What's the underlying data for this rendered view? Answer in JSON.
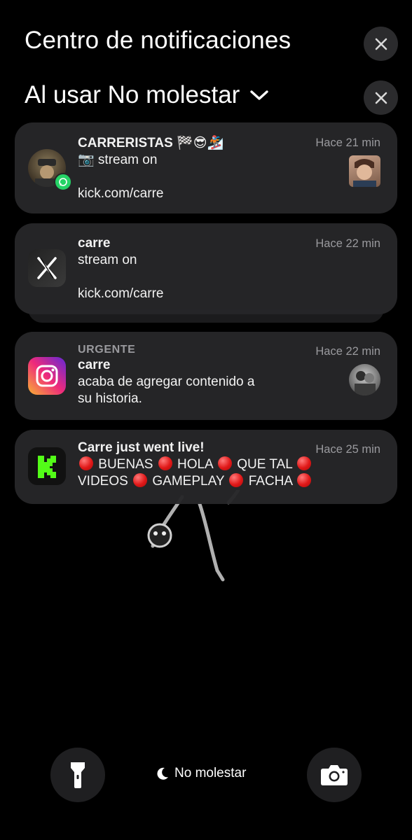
{
  "header": {
    "title": "Centro de notificaciones",
    "focus_label": "Al usar No molestar"
  },
  "notifications": [
    {
      "app": "WhatsApp",
      "sender": "CARRERISTAS 🏁😎🏂",
      "line1": "📷 stream on",
      "line2": "kick.com/carre",
      "time": "Hace 21 min"
    },
    {
      "app": "X",
      "sender": "carre",
      "line1": "stream on",
      "line2": "kick.com/carre",
      "time": "Hace 22 min"
    },
    {
      "app": "Instagram",
      "tag": "URGENTE",
      "sender": "carre",
      "line1": "acaba de agregar contenido a",
      "line2": "su historia.",
      "time": "Hace 22 min"
    },
    {
      "app": "Kick",
      "sender": "Carre just went live!",
      "words_line1": [
        "BUENAS",
        "HOLA",
        "QUE TAL"
      ],
      "words_line2": [
        "VIDEOS",
        "GAMEPLAY",
        "FACHA"
      ],
      "time": "Hace 25 min"
    }
  ],
  "footer": {
    "dnd_label": "No molestar"
  },
  "colors": {
    "kick_green": "#53fc18",
    "whatsapp_green": "#25d366",
    "red_dot": "#e01818"
  }
}
